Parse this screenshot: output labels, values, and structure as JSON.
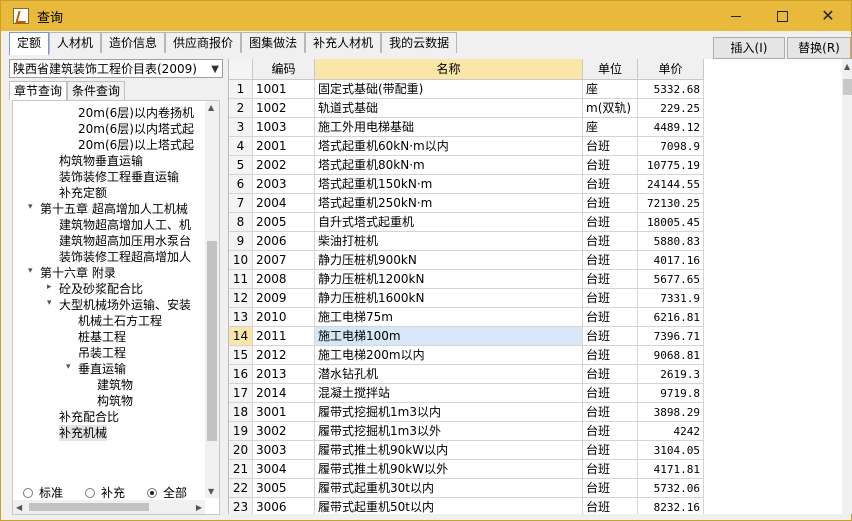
{
  "window": {
    "title": "查询"
  },
  "tabs": [
    "定额",
    "人材机",
    "造价信息",
    "供应商报价",
    "图集做法",
    "补充人材机",
    "我的云数据"
  ],
  "toolbar": {
    "insert_label": "插入(I)",
    "replace_label": "替换(R)"
  },
  "left": {
    "library": "陕西省建筑装饰工程价目表(2009)",
    "subtabs": [
      "章节查询",
      "条件查询"
    ],
    "tree": [
      {
        "label": "20m(6层)以内卷扬机"
      },
      {
        "label": "20m(6层)以内塔式起"
      },
      {
        "label": "20m(6层)以上塔式起"
      },
      {
        "label": "构筑物垂直运输"
      },
      {
        "label": "装饰装修工程垂直运输"
      },
      {
        "label": "补充定额"
      },
      {
        "label": "第十五章 超高增加人工机械",
        "toggle": "expanded"
      },
      {
        "label": "建筑物超高增加人工、机"
      },
      {
        "label": "建筑物超高加压用水泵台"
      },
      {
        "label": "装饰装修工程超高增加人"
      },
      {
        "label": "第十六章 附录",
        "toggle": "expanded"
      },
      {
        "label": "砼及砂浆配合比",
        "toggle": "collapsed"
      },
      {
        "label": "大型机械场外运输、安装",
        "toggle": "expanded"
      },
      {
        "label": "机械土石方工程"
      },
      {
        "label": "桩基工程"
      },
      {
        "label": "吊装工程"
      },
      {
        "label": "垂直运输",
        "toggle": "expanded"
      },
      {
        "label": "建筑物"
      },
      {
        "label": "构筑物"
      },
      {
        "label": "补充配合比"
      },
      {
        "label": "补充机械",
        "selected": true
      }
    ],
    "radios": [
      {
        "label": "标准",
        "checked": false
      },
      {
        "label": "补充",
        "checked": false
      },
      {
        "label": "全部",
        "checked": true
      }
    ]
  },
  "grid": {
    "columns": [
      "",
      "编码",
      "名称",
      "单位",
      "单价"
    ],
    "selected_row": 14,
    "rows": [
      [
        "1",
        "1001",
        "固定式基础(带配重)",
        "座",
        "5332.68"
      ],
      [
        "2",
        "1002",
        "轨道式基础",
        "m(双轨)",
        "229.25"
      ],
      [
        "3",
        "1003",
        "施工外用电梯基础",
        "座",
        "4489.12"
      ],
      [
        "4",
        "2001",
        "塔式起重机60kN·m以内",
        "台班",
        "7098.9"
      ],
      [
        "5",
        "2002",
        "塔式起重机80kN·m",
        "台班",
        "10775.19"
      ],
      [
        "6",
        "2003",
        "塔式起重机150kN·m",
        "台班",
        "24144.55"
      ],
      [
        "7",
        "2004",
        "塔式起重机250kN·m",
        "台班",
        "72130.25"
      ],
      [
        "8",
        "2005",
        "自升式塔式起重机",
        "台班",
        "18005.45"
      ],
      [
        "9",
        "2006",
        "柴油打桩机",
        "台班",
        "5880.83"
      ],
      [
        "10",
        "2007",
        "静力压桩机900kN",
        "台班",
        "4017.16"
      ],
      [
        "11",
        "2008",
        "静力压桩机1200kN",
        "台班",
        "5677.65"
      ],
      [
        "12",
        "2009",
        "静力压桩机1600kN",
        "台班",
        "7331.9"
      ],
      [
        "13",
        "2010",
        "施工电梯75m",
        "台班",
        "6216.81"
      ],
      [
        "14",
        "2011",
        "施工电梯100m",
        "台班",
        "7396.71"
      ],
      [
        "15",
        "2012",
        "施工电梯200m以内",
        "台班",
        "9068.81"
      ],
      [
        "16",
        "2013",
        "潜水钻孔机",
        "台班",
        "2619.3"
      ],
      [
        "17",
        "2014",
        "混凝土搅拌站",
        "台班",
        "9719.8"
      ],
      [
        "18",
        "3001",
        "履带式挖掘机1m3以内",
        "台班",
        "3898.29"
      ],
      [
        "19",
        "3002",
        "履带式挖掘机1m3以外",
        "台班",
        "4242"
      ],
      [
        "20",
        "3003",
        "履带式推土机90kW以内",
        "台班",
        "3104.05"
      ],
      [
        "21",
        "3004",
        "履带式推土机90kW以外",
        "台班",
        "4171.81"
      ],
      [
        "22",
        "3005",
        "履带式起重机30t以内",
        "台班",
        "5732.06"
      ],
      [
        "23",
        "3006",
        "履带式起重机50t以内",
        "台班",
        "8232.16"
      ]
    ]
  },
  "colors": {
    "titlebar": "#e8b93a",
    "selected_header": "#f9e6a8",
    "selected_name": "#d6e8f7"
  }
}
